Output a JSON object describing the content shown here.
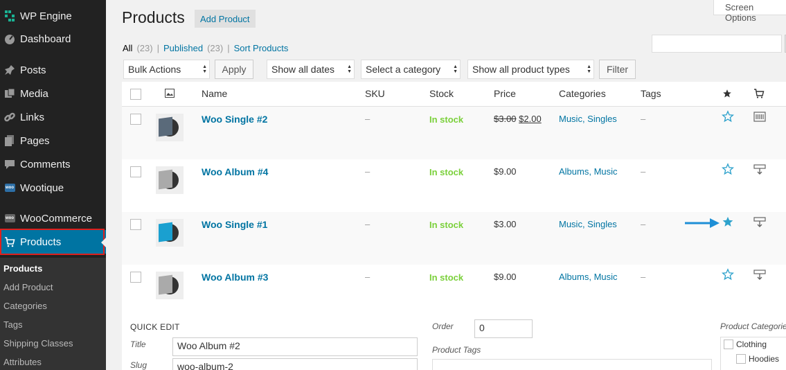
{
  "sidebar": {
    "brand": "WP Engine",
    "items": [
      {
        "label": "Dashboard",
        "icon": "dashboard-icon"
      },
      {
        "label": "Posts",
        "icon": "pin-icon"
      },
      {
        "label": "Media",
        "icon": "media-icon"
      },
      {
        "label": "Links",
        "icon": "link-icon"
      },
      {
        "label": "Pages",
        "icon": "pages-icon"
      },
      {
        "label": "Comments",
        "icon": "comment-icon"
      },
      {
        "label": "Wootique",
        "icon": "woo-icon"
      },
      {
        "label": "WooCommerce",
        "icon": "woo-icon"
      },
      {
        "label": "Products",
        "icon": "cart-icon"
      }
    ],
    "submenu": [
      "Products",
      "Add Product",
      "Categories",
      "Tags",
      "Shipping Classes",
      "Attributes"
    ],
    "woo_badge": "woo"
  },
  "header": {
    "title": "Products",
    "add_button": "Add Product",
    "screen_options": "Screen Options"
  },
  "filters": {
    "all_label": "All",
    "all_count": "(23)",
    "published_label": "Published",
    "published_count": "(23)",
    "sort_label": "Sort Products",
    "separator": "|",
    "bulk_actions": "Bulk Actions",
    "apply": "Apply",
    "dates": "Show all dates",
    "category": "Select a category",
    "product_types": "Show all product types",
    "filter": "Filter"
  },
  "table": {
    "columns": {
      "name": "Name",
      "sku": "SKU",
      "stock": "Stock",
      "price": "Price",
      "categories": "Categories",
      "tags": "Tags"
    },
    "rows": [
      {
        "name": "Woo Single #2",
        "sku": "–",
        "stock": "In stock",
        "price_old": "$3.00",
        "price": "$2.00",
        "categories": "Music, Singles",
        "tags": "–",
        "featured": false
      },
      {
        "name": "Woo Album #4",
        "sku": "–",
        "stock": "In stock",
        "price": "$9.00",
        "categories": "Albums, Music",
        "tags": "–",
        "featured": false
      },
      {
        "name": "Woo Single #1",
        "sku": "–",
        "stock": "In stock",
        "price": "$3.00",
        "categories": "Music, Singles",
        "tags": "–",
        "featured": true
      },
      {
        "name": "Woo Album #3",
        "sku": "–",
        "stock": "In stock",
        "price": "$9.00",
        "categories": "Albums, Music",
        "tags": "–",
        "featured": false
      }
    ]
  },
  "quick_edit": {
    "heading": "QUICK EDIT",
    "title_label": "Title",
    "title_value": "Woo Album #2",
    "slug_label": "Slug",
    "slug_value": "woo-album-2",
    "order_label": "Order",
    "order_value": "0",
    "tags_label": "Product Tags",
    "categories_label": "Product Categories",
    "categories": [
      "Clothing",
      "Hoodies"
    ]
  },
  "colors": {
    "accent": "#0074a2",
    "in_stock": "#7ad03a",
    "sidebar": "#222222",
    "highlight": "#e0201d"
  }
}
